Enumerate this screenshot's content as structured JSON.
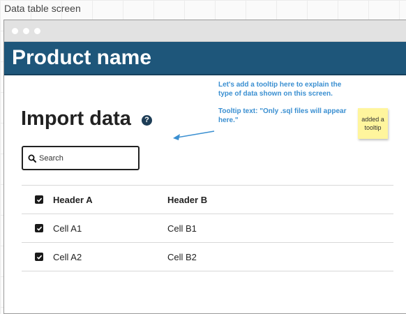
{
  "screen_label": "Data table screen",
  "window": {
    "dots": 3
  },
  "app": {
    "product_name": "Product name"
  },
  "main": {
    "heading": "Import data",
    "help_glyph": "?",
    "search_placeholder": "Search"
  },
  "table": {
    "headers": [
      "Header A",
      "Header B"
    ],
    "header_checked": true,
    "rows": [
      {
        "a": "Cell A1",
        "b": "Cell B1",
        "checked": true
      },
      {
        "a": "Cell A2",
        "b": "Cell B2",
        "checked": true
      }
    ]
  },
  "annotation": {
    "line1": "Let's add a tooltip here to explain the type of data shown on this screen.",
    "line2": "Tooltip text: \"Only .sql files will appear here.\""
  },
  "sticky_note": {
    "text": "added a tooltip"
  },
  "colors": {
    "brand": "#1e567a",
    "annotation": "#3a8fd1",
    "sticky": "#fff59d"
  }
}
